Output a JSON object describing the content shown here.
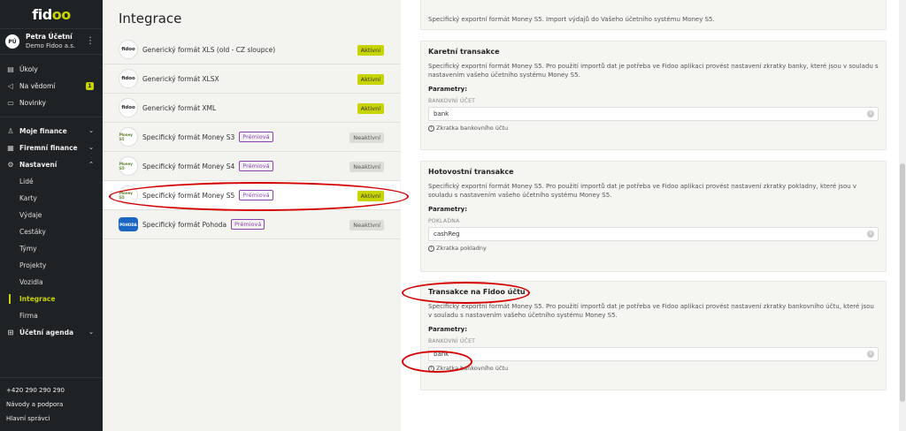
{
  "sidebar": {
    "logo_prefix": "fid",
    "logo_accent": "oo",
    "user": {
      "initials": "PÚ",
      "name": "Petra Účetní",
      "company": "Demo Fidoo a.s."
    },
    "top_items": [
      {
        "label": "Úkoly",
        "icon": "checklist-icon"
      },
      {
        "label": "Na vědomí",
        "icon": "megaphone-icon",
        "badge": "1"
      },
      {
        "label": "Novinky",
        "icon": "inbox-icon"
      }
    ],
    "groups": {
      "moje_finance": "Moje finance",
      "firemni_finance": "Firemní finance",
      "nastaveni": "Nastavení",
      "ucetni_agenda": "Účetní agenda"
    },
    "sub_items": [
      "Lidé",
      "Karty",
      "Výdaje",
      "Cestáky",
      "Týmy",
      "Projekty",
      "Vozidla",
      "Integrace",
      "Firma"
    ],
    "footer": {
      "phone": "+420 290 290 290",
      "help": "Návody a podpora",
      "admins": "Hlavní správci"
    }
  },
  "middle": {
    "title": "Integrace",
    "integrations": [
      {
        "name": "Generický formát XLS (old - CZ sloupce)",
        "logo": "fidoo",
        "premium": "",
        "status": "Aktivní",
        "active": true
      },
      {
        "name": "Generický formát XLSX",
        "logo": "fidoo",
        "premium": "",
        "status": "Aktivní",
        "active": true
      },
      {
        "name": "Generický formát XML",
        "logo": "fidoo",
        "premium": "",
        "status": "Aktivní",
        "active": true
      },
      {
        "name": "Specifický formát Money S3",
        "logo": "money",
        "premium": "Prémiová",
        "status": "Neaktivní",
        "active": false
      },
      {
        "name": "Specifický formát Money S4",
        "logo": "money",
        "premium": "Prémiová",
        "status": "Neaktivní",
        "active": false
      },
      {
        "name": "Specifický formát Money S5",
        "logo": "money",
        "premium": "Prémiová",
        "status": "Aktivní",
        "active": true
      },
      {
        "name": "Specifický formát Pohoda",
        "logo": "pohoda",
        "premium": "Prémiová",
        "status": "Neaktivní",
        "active": false
      }
    ],
    "logo_texts": {
      "fidoo": "fidoo",
      "money": "Money S5",
      "pohoda": "POHODA"
    }
  },
  "detail": {
    "top_card_desc": "Specifický exportní formát Money S5. Import výdajů do Vašeho účetního systému Money S5.",
    "params_label": "Parametry:",
    "cards": [
      {
        "title": "Karetní transakce",
        "desc": "Specifický exportní formát Money S5. Pro použití importů dat je potřeba ve Fidoo aplikaci provést nastavení zkratky banky, které jsou v souladu s nastavením vašeho účetního systému Money S5.",
        "field_label": "BANKOVNÍ ÚČET",
        "field_value": "bank",
        "hint": "Zkratka bankovního účtu"
      },
      {
        "title": "Hotovostní transakce",
        "desc": "Specifický exportní formát Money S5. Pro použití importů dat je potřeba ve Fidoo aplikaci provést nastavení zkratky pokladny, které jsou v souladu s nastavením vašeho účetního systému Money S5.",
        "field_label": "POKLADNA",
        "field_value": "cashReg",
        "hint": "Zkratka pokladny"
      },
      {
        "title": "Transakce na Fidoo účtu",
        "desc": "Specifický exportní formát Money S5. Pro použití importů dat je potřeba ve Fidoo aplikaci provést nastavení zkratky bankovního účtu, které jsou v souladu s nastavením vašeho účetního systému Money S5.",
        "field_label": "BANKOVNÍ ÚČET",
        "field_value": "bank",
        "hint": "Zkratka bankovního účtu"
      }
    ]
  },
  "colors": {
    "accent": "#c8d400",
    "sidebar_bg": "#1f2224",
    "premium": "#8a3fb5",
    "annotation": "#d40000"
  }
}
